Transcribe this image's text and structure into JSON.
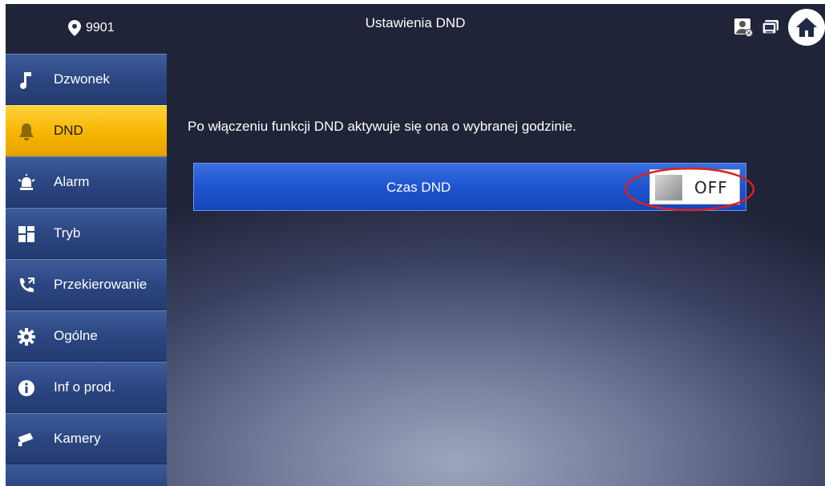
{
  "header": {
    "location_number": "9901",
    "title": "Ustawienia DND",
    "icons": [
      "contact-card-icon",
      "monitor-icon",
      "home-icon"
    ]
  },
  "sidebar": {
    "items": [
      {
        "label": "Dzwonek",
        "icon": "music-note-icon",
        "active": false
      },
      {
        "label": "DND",
        "icon": "bell-icon",
        "active": true
      },
      {
        "label": "Alarm",
        "icon": "alarm-siren-icon",
        "active": false
      },
      {
        "label": "Tryb",
        "icon": "grid-mode-icon",
        "active": false
      },
      {
        "label": "Przekierowanie",
        "icon": "call-forward-icon",
        "active": false
      },
      {
        "label": "Ogólne",
        "icon": "gear-icon",
        "active": false
      },
      {
        "label": "Inf o prod.",
        "icon": "info-icon",
        "active": false
      },
      {
        "label": "Kamery",
        "icon": "camera-icon",
        "active": false
      }
    ]
  },
  "content": {
    "info_text": "Po włączeniu funkcji DND aktywuje się ona o wybranej godzinie.",
    "dnd_row": {
      "label": "Czas DND",
      "toggle_state": "OFF"
    }
  },
  "colors": {
    "active_item": "#f7b500",
    "menu_item": "#2c4682",
    "row_blue": "#1d55d0",
    "highlight": "#e01e1e"
  }
}
